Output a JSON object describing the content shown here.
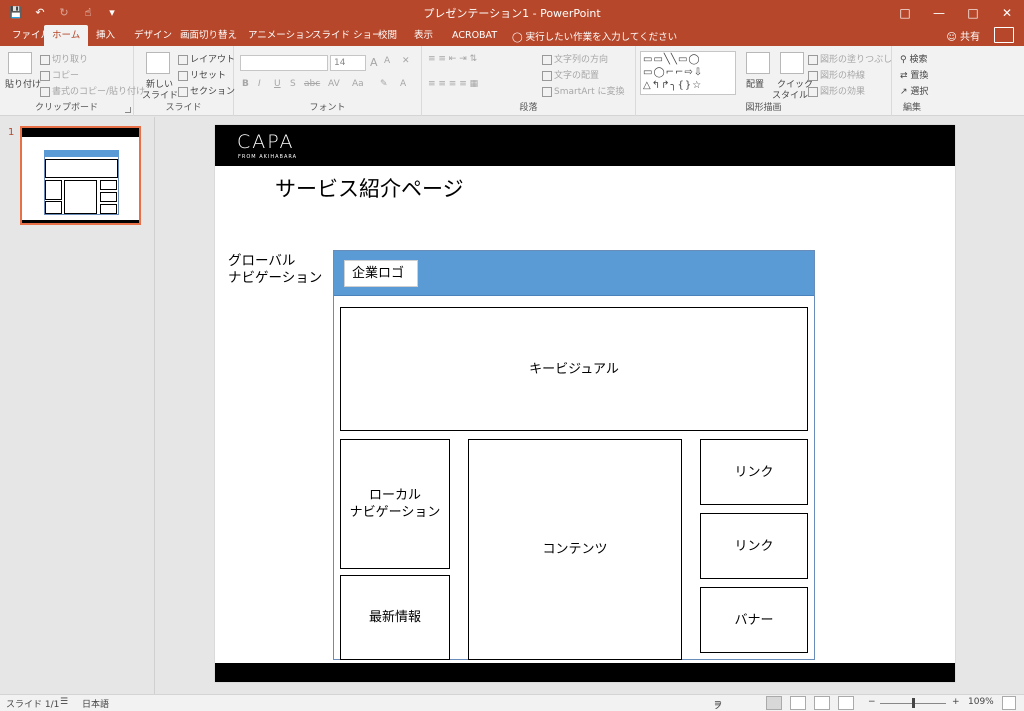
{
  "window": {
    "title": "プレゼンテーション1 - PowerPoint",
    "qat": [
      "save-icon",
      "undo-icon",
      "redo-icon",
      "touch-mode-icon",
      "customize-icon"
    ],
    "controls": [
      "ribbon-display-icon",
      "minimize-icon",
      "maximize-icon",
      "close-icon"
    ]
  },
  "tabs": [
    "ファイル",
    "ホーム",
    "挿入",
    "デザイン",
    "画面切り替え",
    "アニメーション",
    "スライド ショー",
    "校閲",
    "表示",
    "ACROBAT"
  ],
  "active_tab": "ホーム",
  "tellme": "実行したい作業を入力してください",
  "share": "共有",
  "ribbon": {
    "clipboard": {
      "paste": "貼り付け",
      "cut": "切り取り",
      "copy": "コピー",
      "format_painter": "書式のコピー/貼り付け",
      "label": "クリップボード"
    },
    "slides": {
      "new_slide": "新しい",
      "new_slide2": "スライド",
      "layout": "レイアウト",
      "reset": "リセット",
      "section": "セクション",
      "label": "スライド"
    },
    "font": {
      "size": "14",
      "label": "フォント",
      "bold": "B",
      "italic": "I",
      "underline": "U",
      "shadow": "S",
      "strike": "abc",
      "spacing": "AV",
      "case": "Aa",
      "grow": "A",
      "shrink": "A"
    },
    "paragraph": {
      "text_direction": "文字列の方向",
      "align_text": "文字の配置",
      "smartart": "SmartArt に変換",
      "label": "段落"
    },
    "drawing": {
      "arrange": "配置",
      "quick_styles": "クイック",
      "quick_styles2": "スタイル",
      "fill": "図形の塗りつぶし",
      "outline": "図形の枠線",
      "effects": "図形の効果",
      "label": "図形描画"
    },
    "editing": {
      "find": "検索",
      "replace": "置換",
      "select": "選択",
      "label": "編集"
    }
  },
  "thumbnail_number": "1",
  "slide": {
    "logo": "CAPA",
    "logo_sub": "FROM AKIHABARA",
    "title": "サービス紹介ページ",
    "gnav_label_1": "グローバル",
    "gnav_label_2": "ナビゲーション",
    "company_logo": "企業ロゴ",
    "key_visual": "キービジュアル",
    "local_nav_1": "ローカル",
    "local_nav_2": "ナビゲーション",
    "news": "最新情報",
    "contents": "コンテンツ",
    "link1": "リンク",
    "link2": "リンク",
    "banner": "バナー"
  },
  "statusbar": {
    "slide": "スライド 1/1",
    "language": "日本語",
    "notes": "ノート",
    "zoom": "109%",
    "zoom_minus": "−",
    "zoom_plus": "+"
  }
}
